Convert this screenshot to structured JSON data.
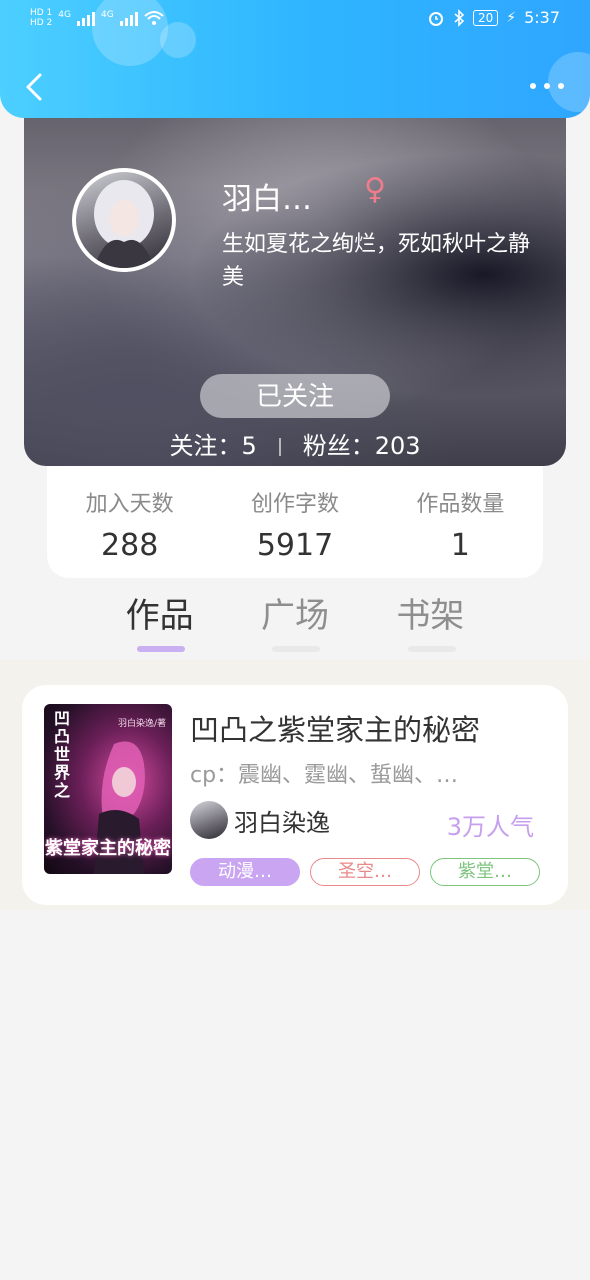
{
  "status_bar": {
    "left_labels": [
      "HD 1",
      "HD 2",
      "4G",
      "4G"
    ],
    "battery": "20",
    "time": "5:37"
  },
  "colors": {
    "header_accent": "#2fb6ff",
    "tab_indicator": "#c9b0f0",
    "popularity": "#c6a0ee"
  },
  "profile": {
    "nickname": "羽白…",
    "gender_symbol": "♀",
    "bio": "生如夏花之绚烂，死如秋叶之静美",
    "follow_button": "已关注",
    "following": "关注：5",
    "fans": "粉丝：203"
  },
  "stats": [
    {
      "label": "加入天数",
      "value": "288"
    },
    {
      "label": "创作字数",
      "value": "5917"
    },
    {
      "label": "作品数量",
      "value": "1"
    }
  ],
  "tabs": [
    {
      "label": "作品",
      "active": true
    },
    {
      "label": "广场",
      "active": false
    },
    {
      "label": "书架",
      "active": false
    }
  ],
  "work": {
    "cover_side_text": "凹凸世界之",
    "cover_author": "羽白染逸/著",
    "cover_title": "紫堂家主的秘密",
    "title": "凹凸之紫堂家主的秘密",
    "cp": "cp：震幽、霆幽、蜇幽、…",
    "author": "羽白染逸",
    "popularity": "3万人气",
    "tags": [
      "动漫…",
      "圣空…",
      "紫堂…"
    ]
  }
}
